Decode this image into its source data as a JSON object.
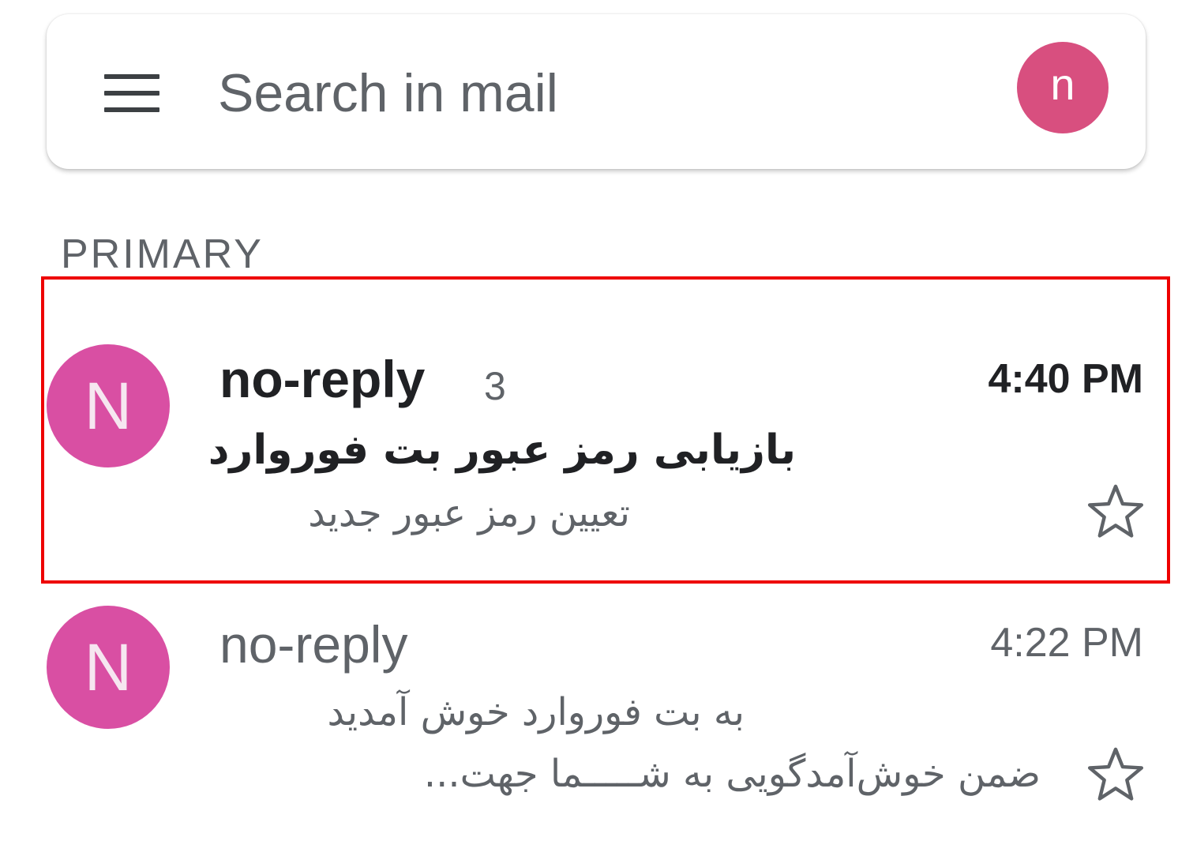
{
  "search_bar": {
    "placeholder": "Search in mail",
    "account_initial": "n",
    "account_color": "#d84f7f"
  },
  "icons": {
    "menu": "hamburger-menu-icon",
    "star": "star-outline-icon"
  },
  "section": {
    "label": "PRIMARY"
  },
  "emails": [
    {
      "avatar_initial": "N",
      "sender": "no-reply",
      "thread_count": "3",
      "time": "4:40 PM",
      "subject": "بازیابی رمز عبور بت فوروارد",
      "snippet": "تعیین رمز عبور جدید",
      "unread": true,
      "starred": false,
      "highlighted": true
    },
    {
      "avatar_initial": "N",
      "sender": "no-reply",
      "time": "4:22 PM",
      "subject": "به بت فوروارد خوش آمدید",
      "snippet": "ضمن خوش‌آمدگویی به شـــــما جهت...",
      "unread": false,
      "starred": false,
      "highlighted": false
    }
  ],
  "colors": {
    "avatar": "#d94fa3",
    "highlight_border": "#ee0000",
    "text_primary": "#202124",
    "text_secondary": "#5f6368"
  }
}
